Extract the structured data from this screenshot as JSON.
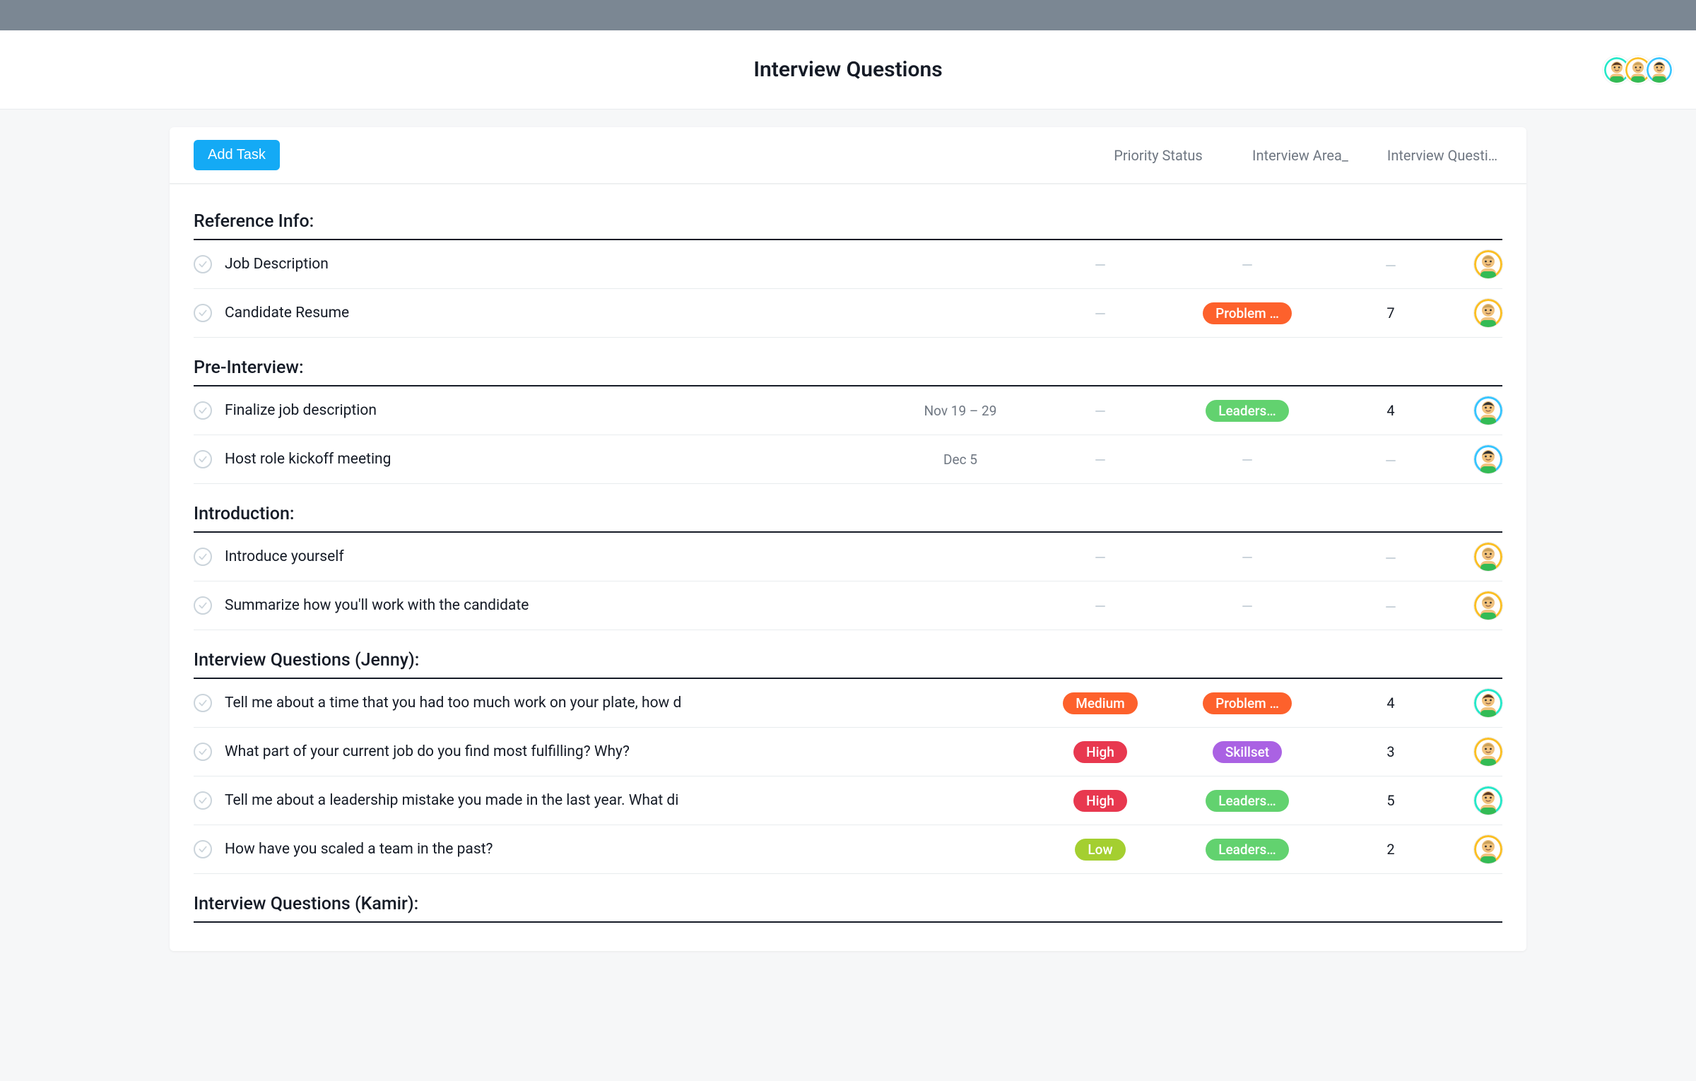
{
  "colors": {
    "orange": "#fd612c",
    "red": "#e8384f",
    "green": "#62d26f",
    "lime": "#a4cf30",
    "purple": "#aa62e3",
    "teal": "#25e8c8",
    "pink": "#fc91ad",
    "yellow": "#fbbf24",
    "blue": "#37c5ff"
  },
  "header": {
    "title": "Interview Questions",
    "avatars": [
      "teal",
      "yellow",
      "blue"
    ]
  },
  "toolbar": {
    "add_task_label": "Add Task",
    "columns": {
      "priority": "Priority Status",
      "area": "Interview Area_",
      "questions": "Interview Questi…"
    }
  },
  "sections": [
    {
      "title": "Reference Info:",
      "tasks": [
        {
          "name": "Job Description",
          "date": "",
          "priority": null,
          "area": null,
          "count": null,
          "assignee": "yellow"
        },
        {
          "name": "Candidate Resume",
          "date": "",
          "priority": null,
          "area": {
            "label": "Problem …",
            "color": "orange"
          },
          "count": 7,
          "assignee": "yellow"
        }
      ]
    },
    {
      "title": "Pre-Interview:",
      "tasks": [
        {
          "name": "Finalize job description",
          "date": "Nov 19 – 29",
          "priority": null,
          "area": {
            "label": "Leaders…",
            "color": "green"
          },
          "count": 4,
          "assignee": "blue"
        },
        {
          "name": "Host role kickoff meeting",
          "date": "Dec 5",
          "priority": null,
          "area": null,
          "count": null,
          "assignee": "blue"
        }
      ]
    },
    {
      "title": "Introduction:",
      "tasks": [
        {
          "name": "Introduce yourself",
          "date": "",
          "priority": null,
          "area": null,
          "count": null,
          "assignee": "yellow"
        },
        {
          "name": "Summarize how you'll work with the candidate",
          "date": "",
          "priority": null,
          "area": null,
          "count": null,
          "assignee": "yellow"
        }
      ]
    },
    {
      "title": "Interview Questions (Jenny):",
      "tasks": [
        {
          "name": "Tell me about a time that you had too much work on your plate, how d",
          "date": "",
          "priority": {
            "label": "Medium",
            "color": "orange"
          },
          "area": {
            "label": "Problem …",
            "color": "orange"
          },
          "count": 4,
          "assignee": "teal"
        },
        {
          "name": "What part of your current job do you find most fulfilling? Why?",
          "date": "",
          "priority": {
            "label": "High",
            "color": "red"
          },
          "area": {
            "label": "Skillset",
            "color": "purple"
          },
          "count": 3,
          "assignee": "yellow"
        },
        {
          "name": "Tell me about a leadership mistake you made in the last year. What di",
          "date": "",
          "priority": {
            "label": "High",
            "color": "red"
          },
          "area": {
            "label": "Leaders…",
            "color": "green"
          },
          "count": 5,
          "assignee": "teal"
        },
        {
          "name": "How have you scaled a team in the past?",
          "date": "",
          "priority": {
            "label": "Low",
            "color": "lime"
          },
          "area": {
            "label": "Leaders…",
            "color": "green"
          },
          "count": 2,
          "assignee": "yellow"
        }
      ]
    },
    {
      "title": "Interview Questions (Kamir):",
      "tasks": []
    }
  ]
}
